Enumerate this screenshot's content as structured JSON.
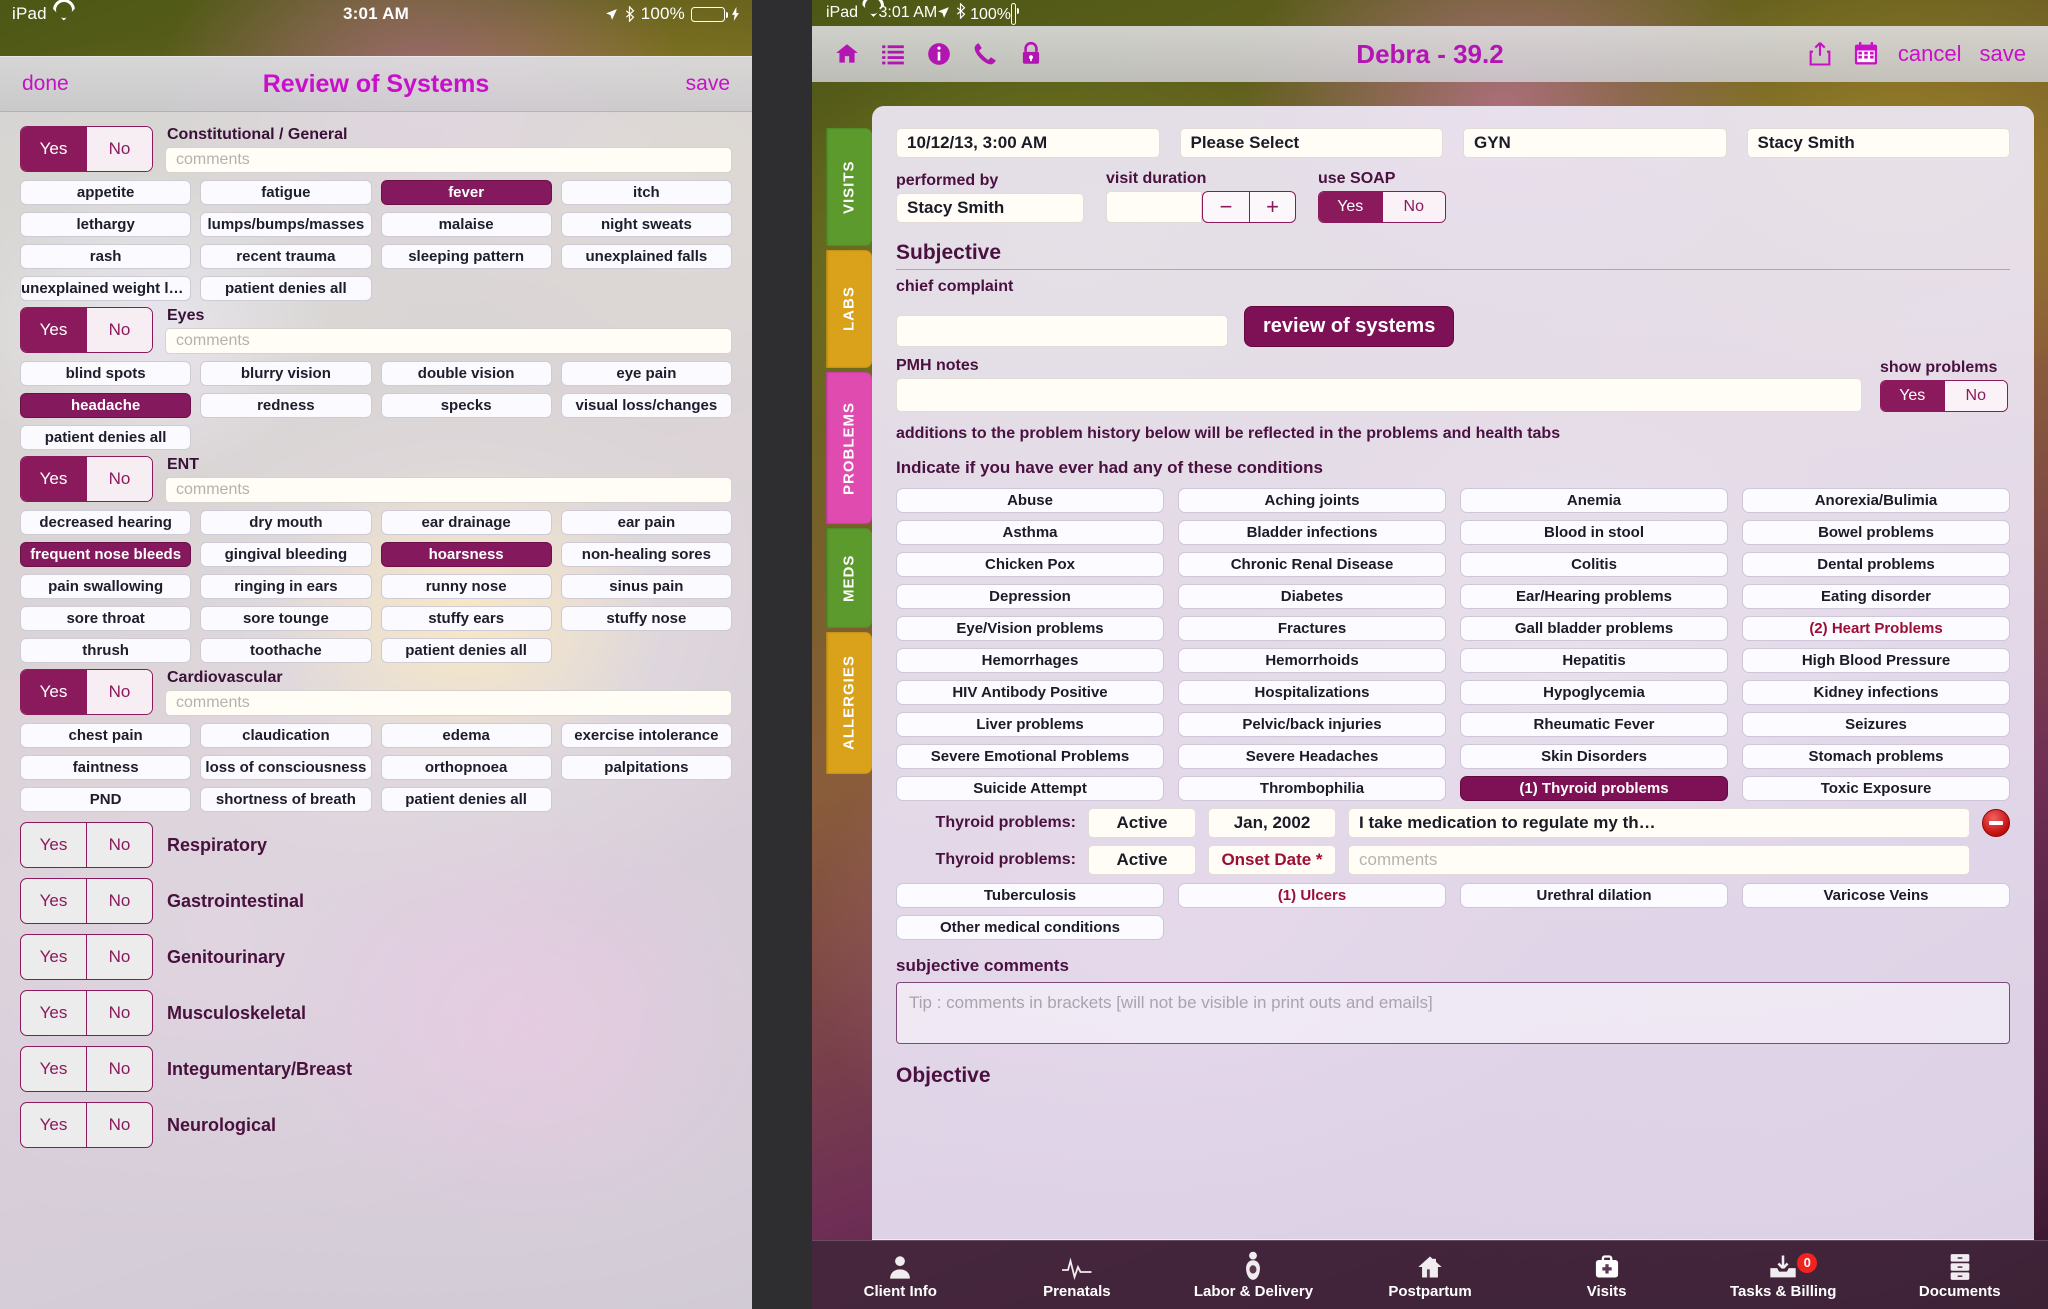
{
  "left": {
    "status": {
      "device": "iPad",
      "time": "3:01 AM",
      "battery": "100%"
    },
    "header": {
      "done": "done",
      "title": "Review of Systems",
      "save": "save"
    },
    "sections": [
      {
        "title": "Constitutional / General",
        "yes": "Yes",
        "no": "No",
        "answer": "Yes",
        "comments_placeholder": "comments",
        "expanded": true,
        "rows": [
          [
            "appetite",
            "fatigue",
            "fever",
            "itch"
          ],
          [
            "lethargy",
            "lumps/bumps/masses",
            "malaise",
            "night sweats"
          ],
          [
            "rash",
            "recent trauma",
            "sleeping pattern",
            "unexplained falls"
          ],
          [
            "unexplained weight loss",
            "patient denies all",
            "",
            ""
          ]
        ],
        "selected": [
          "fever"
        ]
      },
      {
        "title": "Eyes",
        "yes": "Yes",
        "no": "No",
        "answer": "Yes",
        "comments_placeholder": "comments",
        "expanded": true,
        "rows": [
          [
            "blind spots",
            "blurry vision",
            "double vision",
            "eye pain"
          ],
          [
            "headache",
            "redness",
            "specks",
            "visual loss/changes"
          ],
          [
            "patient denies all",
            "",
            "",
            ""
          ]
        ],
        "selected": [
          "headache"
        ]
      },
      {
        "title": "ENT",
        "yes": "Yes",
        "no": "No",
        "answer": "Yes",
        "comments_placeholder": "comments",
        "expanded": true,
        "rows": [
          [
            "decreased hearing",
            "dry mouth",
            "ear drainage",
            "ear pain"
          ],
          [
            "frequent nose bleeds",
            "gingival bleeding",
            "hoarsness",
            "non-healing sores"
          ],
          [
            "pain swallowing",
            "ringing in ears",
            "runny nose",
            "sinus pain"
          ],
          [
            "sore throat",
            "sore tounge",
            "stuffy ears",
            "stuffy nose"
          ],
          [
            "thrush",
            "toothache",
            "patient denies all",
            ""
          ]
        ],
        "selected": [
          "frequent nose bleeds",
          "hoarsness"
        ]
      },
      {
        "title": "Cardiovascular",
        "yes": "Yes",
        "no": "No",
        "answer": "Yes",
        "comments_placeholder": "comments",
        "expanded": true,
        "rows": [
          [
            "chest pain",
            "claudication",
            "edema",
            "exercise intolerance"
          ],
          [
            "faintness",
            "loss of consciousness",
            "orthopnoea",
            "palpitations"
          ],
          [
            "PND",
            "shortness of breath",
            "patient denies all",
            ""
          ]
        ],
        "selected": []
      }
    ],
    "collapsed_sections": [
      {
        "title": "Respiratory",
        "yes": "Yes",
        "no": "No"
      },
      {
        "title": "Gastrointestinal",
        "yes": "Yes",
        "no": "No"
      },
      {
        "title": "Genitourinary",
        "yes": "Yes",
        "no": "No"
      },
      {
        "title": "Musculoskeletal",
        "yes": "Yes",
        "no": "No"
      },
      {
        "title": "Integumentary/Breast",
        "yes": "Yes",
        "no": "No"
      },
      {
        "title": "Neurological",
        "yes": "Yes",
        "no": "No"
      }
    ]
  },
  "right": {
    "status": {
      "device": "iPad",
      "time": "3:01 AM",
      "battery": "100%"
    },
    "navbar": {
      "icons": [
        "home-icon",
        "list-icon",
        "info-icon",
        "phone-icon",
        "lock-icon"
      ],
      "patient_title": "Debra - 39.2",
      "right_icons": [
        "share-icon",
        "calendar-icon"
      ],
      "cancel": "cancel",
      "save": "save"
    },
    "sidetabs": [
      "Visits",
      "Labs",
      "Problems",
      "Meds",
      "Allergies"
    ],
    "topfields": {
      "date": "10/12/13, 3:00 AM",
      "type": "Please Select",
      "category": "GYN",
      "provider": "Stacy Smith"
    },
    "row2": {
      "performed_by_label": "performed by",
      "performed_by": "Stacy Smith",
      "duration_label": "visit duration",
      "duration_value": "",
      "minus": "−",
      "plus": "+",
      "soap_label": "use SOAP",
      "soap_yes": "Yes",
      "soap_no": "No",
      "soap_answer": "Yes"
    },
    "subjective": {
      "heading": "Subjective",
      "chief_complaint_label": "chief complaint",
      "chief_complaint_value": "",
      "review_button": "review of systems",
      "pmh_label": "PMH notes",
      "pmh_value": "",
      "show_problems_label": "show problems",
      "show_yes": "Yes",
      "show_no": "No",
      "show_answer": "Yes",
      "note": "additions to the problem history below will be reflected in the problems and health tabs",
      "indicate": "Indicate if you have ever had any of these conditions"
    },
    "conditions": [
      [
        "Abuse",
        "Aching joints",
        "Anemia",
        "Anorexia/Bulimia"
      ],
      [
        "Asthma",
        "Bladder infections",
        "Blood in stool",
        "Bowel problems"
      ],
      [
        "Chicken Pox",
        "Chronic Renal Disease",
        "Colitis",
        "Dental problems"
      ],
      [
        "Depression",
        "Diabetes",
        "Ear/Hearing problems",
        "Eating disorder"
      ],
      [
        "Eye/Vision problems",
        "Fractures",
        "Gall bladder problems",
        "(2) Heart Problems"
      ],
      [
        "Hemorrhages",
        "Hemorrhoids",
        "Hepatitis",
        "High Blood Pressure"
      ],
      [
        "HIV Antibody Positive",
        "Hospitalizations",
        "Hypoglycemia",
        "Kidney infections"
      ],
      [
        "Liver problems",
        "Pelvic/back injuries",
        "Rheumatic Fever",
        "Seizures"
      ],
      [
        "Severe Emotional Problems",
        "Severe Headaches",
        "Skin Disorders",
        "Stomach problems"
      ],
      [
        "Suicide Attempt",
        "Thrombophilia",
        "(1) Thyroid problems",
        "Toxic Exposure"
      ]
    ],
    "conditions_selected": [
      "(1) Thyroid problems"
    ],
    "conditions_counted": [
      "(2) Heart Problems"
    ],
    "problem_rows": [
      {
        "label": "Thyroid problems:",
        "status": "Active",
        "date": "Jan, 2002",
        "date_required": false,
        "comment": "I take medication to regulate my th…",
        "comment_is_placeholder": false,
        "has_delete": true
      },
      {
        "label": "Thyroid problems:",
        "status": "Active",
        "date": "Onset Date *",
        "date_required": true,
        "comment": "comments",
        "comment_is_placeholder": true,
        "has_delete": false
      }
    ],
    "conditions_tail": [
      [
        "Tuberculosis",
        "(1) Ulcers",
        "Urethral dilation",
        "Varicose Veins"
      ],
      [
        "Other medical conditions",
        "",
        "",
        ""
      ]
    ],
    "conditions_tail_counted": [
      "(1) Ulcers"
    ],
    "subjective_comments": {
      "label": "subjective comments",
      "placeholder": "Tip : comments in brackets [will not be visible in print outs and emails]"
    },
    "objective_heading": "Objective",
    "tabbar": [
      {
        "label": "Client Info",
        "icon": "person-icon",
        "badge": ""
      },
      {
        "label": "Prenatals",
        "icon": "heartbeat-icon",
        "badge": ""
      },
      {
        "label": "Labor & Delivery",
        "icon": "baby-icon",
        "badge": ""
      },
      {
        "label": "Postpartum",
        "icon": "house-icon",
        "badge": ""
      },
      {
        "label": "Visits",
        "icon": "medical-bag-icon",
        "badge": ""
      },
      {
        "label": "Tasks & Billing",
        "icon": "inbox-icon",
        "badge": "0"
      },
      {
        "label": "Documents",
        "icon": "file-cabinet-icon",
        "badge": ""
      }
    ]
  },
  "colors": {
    "accent_magenta": "#c90fc9",
    "selected_plum": "#7e1156",
    "tab_green": "#5d9a2e",
    "tab_gold": "#d9a21a",
    "tab_pink": "#e04bb0",
    "count_red": "#9c0e35",
    "badge_red": "#f0231f"
  }
}
